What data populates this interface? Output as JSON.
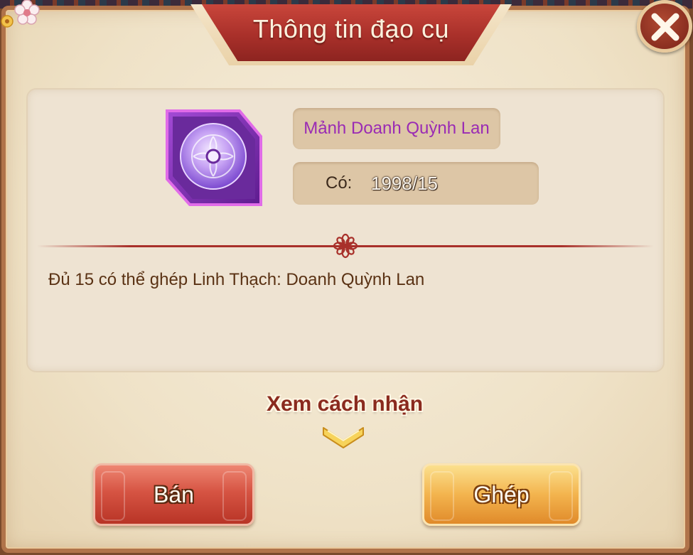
{
  "dialog": {
    "title": "Thông tin đạo cụ",
    "close_icon": "close-icon"
  },
  "item": {
    "icon": "jade-disc-icon",
    "name": "Mảnh Doanh Quỳnh Lan",
    "name_color": "#9a2bb4",
    "count_label": "Có:",
    "count_value": "1998/15",
    "description": "Đủ 15 có thể ghép Linh Thạch: Doanh Quỳnh Lan"
  },
  "how_to_obtain": {
    "label": "Xem cách nhận",
    "icon": "chevron-down-icon"
  },
  "buttons": {
    "sell_label": "Bán",
    "combine_label": "Ghép"
  },
  "colors": {
    "accent_red": "#a9302a",
    "sell_button": "#d65443",
    "combine_button": "#f3b44e",
    "item_purple": "#7a2fb0"
  }
}
